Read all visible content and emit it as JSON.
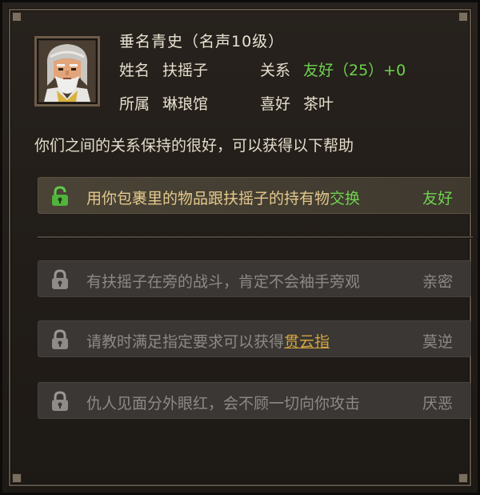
{
  "character": {
    "title": "垂名青史（名声10级）",
    "name_label": "姓名",
    "name": "扶摇子",
    "relation_label": "关系",
    "relation_value": "友好（25）+0",
    "faction_label": "所属",
    "faction": "琳琅馆",
    "hobby_label": "喜好",
    "hobby": "茶叶"
  },
  "description": "你们之间的关系保持的很好，可以获得以下帮助",
  "benefits": [
    {
      "text_before": "用你包裹里的物品跟扶摇子的持有物",
      "highlight": "交换",
      "text_after": "",
      "tag": "友好",
      "unlocked": true
    },
    {
      "text_before": "有扶摇子在旁的战斗，肯定不会袖手旁观",
      "highlight": "",
      "text_after": "",
      "tag": "亲密",
      "unlocked": false
    },
    {
      "text_before": "请教时满足指定要求可以获得",
      "highlight": "贯云指",
      "text_after": "",
      "tag": "莫逆",
      "unlocked": false
    },
    {
      "text_before": "仇人见面分外眼红，会不顾一切向你攻击",
      "highlight": "",
      "text_after": "",
      "tag": "厌恶",
      "unlocked": false
    }
  ],
  "colors": {
    "unlocked_text": "#e3c98d",
    "unlocked_tag": "#6fd24f",
    "locked_text": "#8d8a86",
    "link": "#d4a440"
  },
  "icons": {
    "avatar": "elder-portrait",
    "unlocked": "open-padlock-icon",
    "locked": "padlock-icon"
  }
}
